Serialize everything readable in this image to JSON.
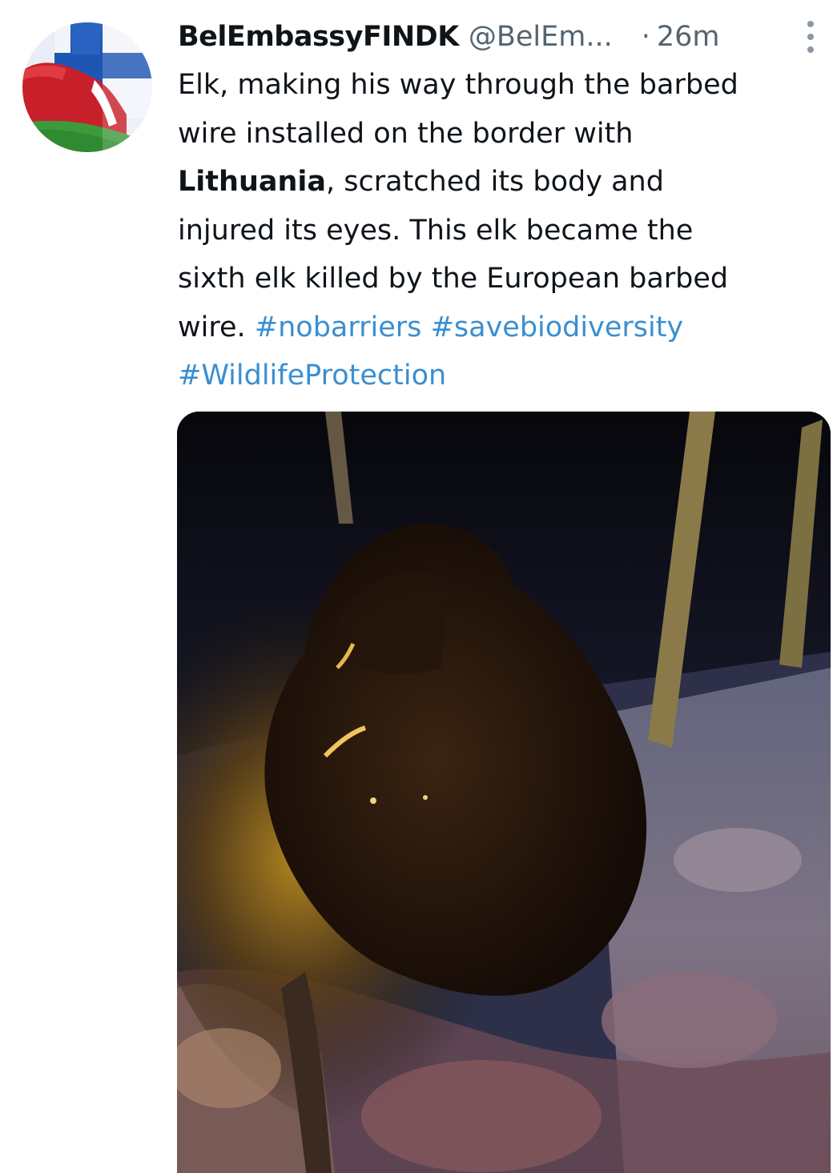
{
  "tweet": {
    "display_name": "BelEmbassyFINDK",
    "handle": "@BelEm...",
    "separator": "·",
    "time": "26m",
    "text": {
      "line1": "Elk, making his way through the barbed",
      "line2": "wire installed on the border with",
      "bold_word": "Lithuania",
      "line3_rest": ", scratched its body and",
      "line4": "injured its eyes.  This elk became the",
      "line5": "sixth elk killed by the European barbed",
      "line6_start": "wire.",
      "hashtags": [
        "#nobarriers",
        "#savebiodiversity",
        "#WildlifeProtection"
      ]
    },
    "avatar_icon": "flag-avatar-icon",
    "more_icon": "vertical-ellipsis-icon",
    "media_description_icon": "photo-media"
  },
  "colors": {
    "text": "#0f1419",
    "secondary": "#536471",
    "hashtag": "#3a8fd1"
  }
}
